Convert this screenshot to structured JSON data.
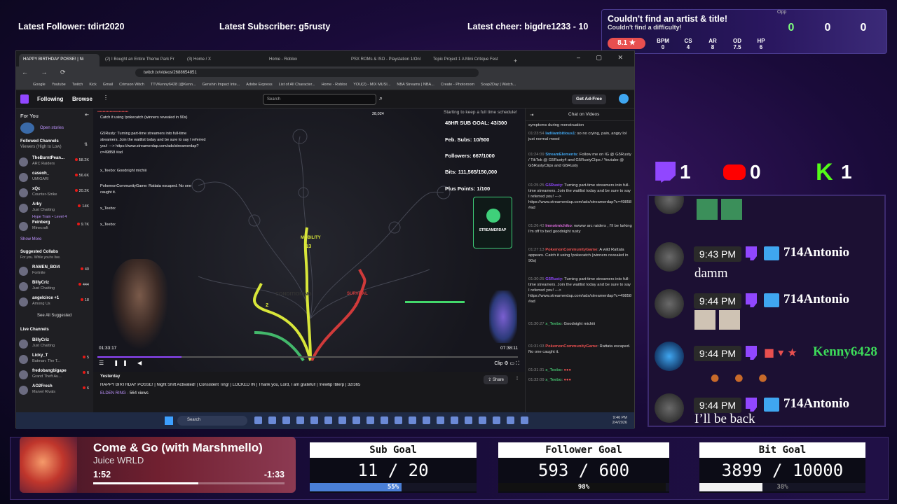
{
  "ticker": {
    "follower": "Latest Follower: tdirt2020",
    "subscriber": "Latest Subscriber: g5rusty",
    "cheer": "Latest cheer: bigdre1233 - 10"
  },
  "game_overlay": {
    "title": "Couldn't find an artist & title!",
    "subtitle": "Couldn't find a difficulty!",
    "stars": "8.1",
    "stats": [
      {
        "label": "BPM",
        "value": "0"
      },
      {
        "label": "CS",
        "value": "4"
      },
      {
        "label": "AR",
        "value": "8"
      },
      {
        "label": "OD",
        "value": "7.5"
      },
      {
        "label": "HP",
        "value": "6"
      }
    ],
    "scores": [
      "0",
      "0",
      "0"
    ],
    "corner_text": "Opp"
  },
  "browser": {
    "tabs": [
      "HAPPY BIRTHDAY POSSE! | Ni",
      "(2) I Bought an Entire Theme Park Fr",
      "(3) Home / X",
      "Home - Roblox",
      "PSX ROMs & ISO - Playstation 1/Onl",
      "Topic Project 1 A Mini Critique Fest"
    ],
    "url": "twitch.tv/videos/2688654851",
    "bookmarks": [
      "Google",
      "Youtube",
      "Twitch",
      "Kick",
      "Gmail",
      "Crimson Witch",
      "TTVKenny6428 (@Kenn...",
      "Genshin Impact Inte...",
      "Adobe Express",
      "List of All Character...",
      "Home - Roblox",
      "YOU(2) - MIX MUSI...",
      "NBA Streams | NBA...",
      "Create - Photoroom",
      "Soap2Day | Watch..."
    ]
  },
  "twitch": {
    "nav_following": "Following",
    "nav_browse": "Browse",
    "search_placeholder": "Search",
    "ad_free": "Get Ad-Free",
    "for_you": "For You",
    "open_stories": "Open stories",
    "followed_channels": "Followed Channels",
    "followed_sort": "Viewers (High to Low)",
    "channels": [
      {
        "name": "TheBurntPean...",
        "game": "ARC Raiders",
        "viewers": "58.2K"
      },
      {
        "name": "caseoh_",
        "game": "UMIGARI",
        "viewers": "56.6K"
      },
      {
        "name": "xQc",
        "game": "Counter-Strike",
        "viewers": "20.2K"
      },
      {
        "name": "Arky",
        "game": "Just Chatting",
        "viewers": "14K"
      },
      {
        "name": "Feinberg",
        "game": "Minecraft",
        "viewers": "9.7K"
      }
    ],
    "hype_train": "Hype Train • Level 4",
    "show_more": "Show More",
    "suggested_title": "Suggested Collabs",
    "suggested_sub": "For you. While you're live.",
    "suggested": [
      {
        "name": "RAMEN_BOI4",
        "game": "Fortnite",
        "viewers": "40"
      },
      {
        "name": "BillyCriz",
        "game": "Just Chatting",
        "viewers": "444"
      },
      {
        "name": "angelcirce +1",
        "game": "Among Us",
        "viewers": "18"
      }
    ],
    "see_all": "See All Suggested",
    "live_channels": "Live Channels",
    "live": [
      {
        "name": "BillyCriz",
        "game": "Just Chatting",
        "viewers": ""
      },
      {
        "name": "Licky_T",
        "game": "Batman: The T...",
        "viewers": "5"
      },
      {
        "name": "fredobangbigape",
        "game": "Grand Theft Au...",
        "viewers": "6"
      },
      {
        "name": "AO2Fresh",
        "game": "Marvel Rivals",
        "viewers": "6"
      }
    ]
  },
  "video": {
    "overlay_goal_title": "Starting to keep a full time schedule!",
    "overlay_goals": [
      "48HR SUB GOAL: 43/300",
      "Feb. Subs: 10/500",
      "Followers: 667/1000",
      "Bits: 111,565/150,000",
      "Plus Points: 1/100"
    ],
    "viewer_count": "28,024",
    "branches": [
      {
        "name": "CONDITIONING",
        "level": "2"
      },
      {
        "name": "MOBILITY",
        "level": "13"
      },
      {
        "name": "SURVIVAL",
        "level": "5"
      }
    ],
    "logo_text": "STREAMERDAP",
    "elapsed": "01:33:17",
    "total": "07:38:11",
    "clip": "Clip",
    "progress": 0.2,
    "overlay_chat": [
      "Catch it using !pokecatch (winners revealed in 90s)",
      "G5Rusty: Turning part-time streamers into full-time",
      "streamers. Join the waitlist today and be sure to say I referred",
      "you! ---> https://www.streamerdap.com/ads/streamerdap?",
      "c=49858 #ad",
      "x_Teebo: Goodnight michiii",
      "PokemonCommunityGame: Rattata escaped. No one",
      "caught it.",
      "x_Teebo:",
      "x_Teebo:"
    ]
  },
  "meta": {
    "date": "Yesterday",
    "title": "HAPPY BIRTHDAY POSSE! | Night Shift Activated! | Consistent Ting! | LOCKED IN | Thank you, Lord, I am grateful! | !newtip !blerp | 32/365",
    "game": "ELDEN RING",
    "views": "564 views",
    "share": "Share"
  },
  "chat_panel": {
    "header": "Chat on Videos",
    "messages": [
      {
        "time": "",
        "user": "",
        "text": "symptoms during menstruation"
      },
      {
        "time": "01:23:54",
        "user": "ladiiambitious1",
        "text": ": so no crying, pain, angry lol just normal mood"
      },
      {
        "time": "01:24:09",
        "user": "StreamElements",
        "text": ": Follow me on IG @ G5Rusty / TikTok @ G5Rusty4 and G5RustyClips / Youtube @ G5RustyClips and G5Rusty"
      },
      {
        "time": "01:25:25",
        "user": "G5Rusty",
        "text": ": Turning part-time streamers into full-time streamers. Join the waitlist today and be sure to say I referred you! ---> https://www.streamerdap.com/ads/streamerdap?c=49858 #ad"
      },
      {
        "time": "01:26:43",
        "user": "lmnotmichiko",
        "text": ": wwww arc raiders , I'll be lurking I'm off to bed goodnight rusty"
      },
      {
        "time": "01:27:13",
        "user": "PokemonCommunityGame",
        "text": ": A wild Rattata appears. Catch it using !pokecatch (winners revealed in 90s)"
      },
      {
        "time": "01:30:25",
        "user": "G5Rusty",
        "text": ": Turning part-time streamers into full-time streamers. Join the waitlist today and be sure to say I referred you! ---> https://www.streamerdap.com/ads/streamerdap?c=49858 #ad"
      },
      {
        "time": "01:30:27",
        "user": "x_Teebo",
        "text": ": Goodnight michiii"
      },
      {
        "time": "01:31:03",
        "user": "PokemonCommunityGame",
        "text": ": Rattata escaped. No one caught it."
      },
      {
        "time": "01:31:31",
        "user": "x_Teebo",
        "text": ":"
      },
      {
        "time": "01:32:09",
        "user": "x_Teebo",
        "text": ":"
      }
    ]
  },
  "taskbar": {
    "search": "Search",
    "time": "9:46 PM",
    "date": "2/4/2026"
  },
  "socials": {
    "twitch": "1",
    "youtube": "0",
    "kick": "1",
    "colors": {
      "twitch": "#9147ff",
      "youtube": "#ff0000",
      "kick": "#53fc18"
    }
  },
  "right_chat": [
    {
      "time": "9:43 PM",
      "name": "714Antonio",
      "text": "damm",
      "name_color": "#ffffff"
    },
    {
      "time": "9:44 PM",
      "name": "714Antonio",
      "text": "",
      "name_color": "#ffffff"
    },
    {
      "time": "9:44 PM",
      "name": "Kenny6428",
      "text": "",
      "name_color": "#3ddc5a"
    },
    {
      "time": "9:44 PM",
      "name": "714Antonio",
      "text": "I’ll be back",
      "name_color": "#ffffff"
    }
  ],
  "music": {
    "title": "Come & Go (with Marshmello)",
    "artist": "Juice WRLD",
    "elapsed": "1:52",
    "remaining": "-1:33",
    "progress": 0.55
  },
  "goals": [
    {
      "title": "Sub Goal",
      "value": "11 / 20",
      "percent_label": "55%",
      "fraction": 0.55,
      "color": "#4a7fd6"
    },
    {
      "title": "Follower Goal",
      "value": "593 / 600",
      "percent_label": "98%",
      "fraction": 0.98,
      "color": "#111"
    },
    {
      "title": "Bit Goal",
      "value": "3899 / 10000",
      "percent_label": "38%",
      "fraction": 0.38,
      "color": "#f2f2f2"
    }
  ]
}
